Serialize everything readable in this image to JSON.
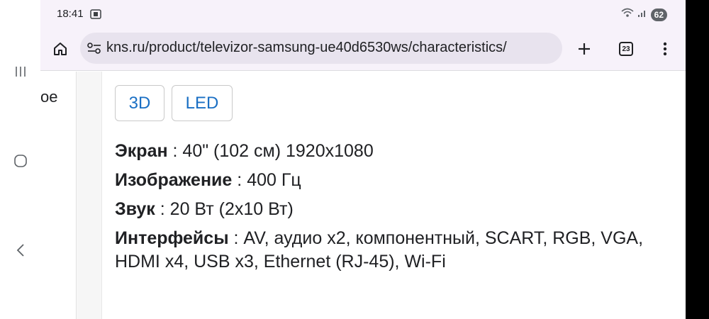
{
  "status_bar": {
    "time": "18:41",
    "battery": "62"
  },
  "toolbar": {
    "url": "kns.ru/product/televizor-samsung-ue40d6530ws/characteristics/",
    "tabs_count": "23"
  },
  "side_panel": {
    "text": "ое"
  },
  "tags": [
    "3D",
    "LED"
  ],
  "specs": [
    {
      "label": "Экран",
      "sep": " : ",
      "value": "40\" (102 см) 1920x1080"
    },
    {
      "label": "Изображение",
      "sep": " : ",
      "value": "400 Гц"
    },
    {
      "label": "Звук",
      "sep": " : ",
      "value": "20 Вт (2x10 Вт)"
    },
    {
      "label": "Интерфейсы",
      "sep": " : ",
      "value": "AV, аудио x2, компонентный, SCART, RGB, VGA, HDMI x4, USB x3, Ethernet (RJ-45), Wi-Fi"
    }
  ],
  "colors": {
    "tag_text": "#1a6fc4",
    "toolbar_bg": "#f7f2fa"
  },
  "icons": {
    "nav_recents": "recents-icon",
    "nav_home": "home-circle-icon",
    "nav_back": "back-icon",
    "browser_home": "home-icon",
    "site_settings": "tune-icon",
    "new_tab": "plus-icon",
    "menu": "more-vert-icon"
  }
}
